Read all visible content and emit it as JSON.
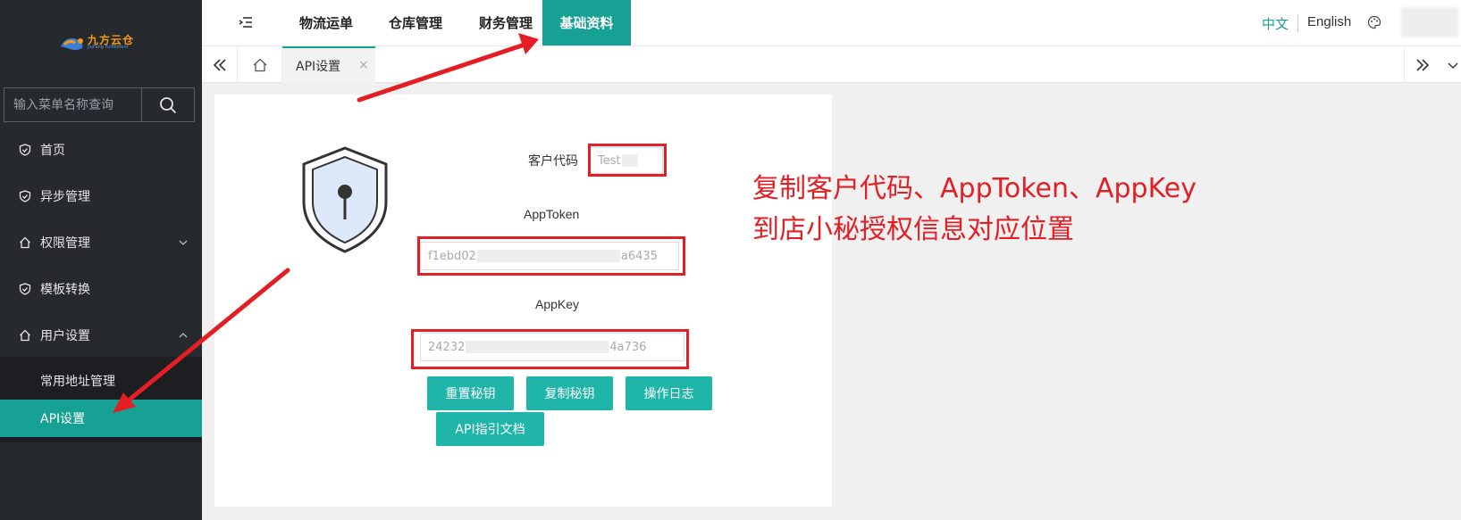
{
  "logo": {
    "text": "九方云仓",
    "sub": "JiuFang Fulfillment"
  },
  "sidebar": {
    "search_placeholder": "输入菜单名称查询",
    "items": [
      {
        "label": "首页"
      },
      {
        "label": "异步管理"
      },
      {
        "label": "权限管理"
      },
      {
        "label": "模板转换"
      },
      {
        "label": "用户设置"
      }
    ],
    "submenu": [
      {
        "label": "常用地址管理"
      },
      {
        "label": "API设置"
      }
    ]
  },
  "topnav": {
    "items": [
      {
        "label": "物流运单"
      },
      {
        "label": "仓库管理"
      },
      {
        "label": "财务管理"
      },
      {
        "label": "基础资料"
      }
    ],
    "lang_zh": "中文",
    "lang_en": "English"
  },
  "tabs": {
    "active_label": "API设置",
    "close": "×"
  },
  "form": {
    "customer_code_label": "客户代码",
    "customer_code_value": "Test",
    "apptoken_label": "AppToken",
    "apptoken_start": "f1ebd02",
    "apptoken_end": "a6435",
    "appkey_label": "AppKey",
    "appkey_start": "24232",
    "appkey_end": "4a736",
    "buttons": {
      "reset": "重置秘钥",
      "copy": "复制秘钥",
      "log": "操作日志",
      "docs": "API指引文档"
    }
  },
  "annotation": {
    "line1": "复制客户代码、AppToken、AppKey",
    "line2": "到店小秘授权信息对应位置"
  },
  "colors": {
    "accent": "#17a194",
    "sidebar": "#26292e",
    "annotation": "#e31e24"
  }
}
